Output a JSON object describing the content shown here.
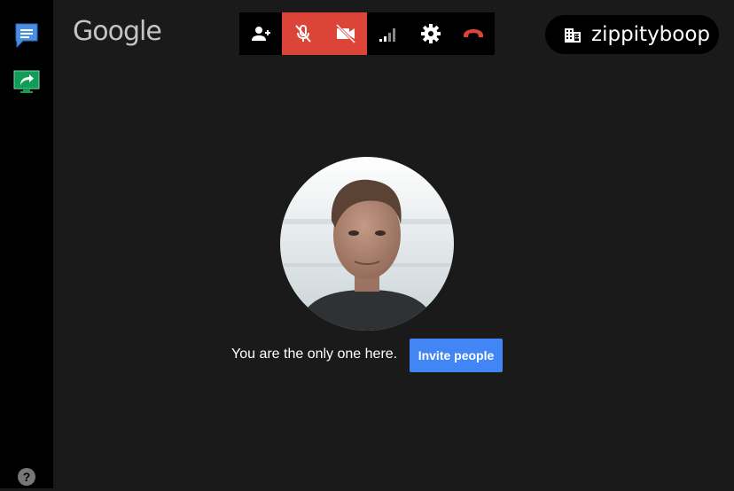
{
  "sidebar": {
    "items": [
      {
        "icon": "chat-icon",
        "color": "#4285f4"
      },
      {
        "icon": "present-screen-icon",
        "color": "#0f9d58"
      }
    ],
    "help_icon": "help-icon"
  },
  "header": {
    "logo": "Google"
  },
  "toolbar": {
    "buttons": [
      {
        "icon": "add-person-icon",
        "active": false
      },
      {
        "icon": "mic-off-icon",
        "active": true
      },
      {
        "icon": "camera-off-icon",
        "active": true
      },
      {
        "icon": "signal-icon",
        "active": false
      },
      {
        "icon": "gear-icon",
        "active": false
      },
      {
        "icon": "hang-up-icon",
        "active": false
      }
    ],
    "active_color": "#db4437",
    "hangup_color": "#db4437"
  },
  "room": {
    "icon": "building-icon",
    "name": "zippityboop"
  },
  "main": {
    "empty_message": "You are the only one here.",
    "invite_label": "Invite people",
    "invite_color": "#4285f4"
  }
}
